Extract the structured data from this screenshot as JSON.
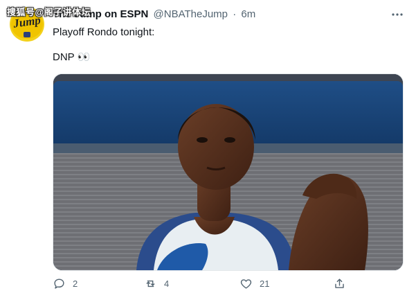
{
  "watermark": {
    "text": "搜狐号@阁子讲体坛"
  },
  "tweet": {
    "display_name": "The Jump on ESPN",
    "handle": "@NBATheJump",
    "separator": "·",
    "time": "6m",
    "lines": [
      "Playoff Rondo tonight:",
      "DNP 👀"
    ]
  },
  "avatar": {
    "text": "Jump"
  },
  "media": {
    "description_icon": "photo-of-player-seated-hands-clasped"
  },
  "actions": {
    "reply_count": "2",
    "retweet_count": "4",
    "like_count": "21"
  },
  "colors": {
    "text_primary": "#0f1419",
    "text_secondary": "#536471",
    "jersey_blue": "#0b3c8c"
  }
}
